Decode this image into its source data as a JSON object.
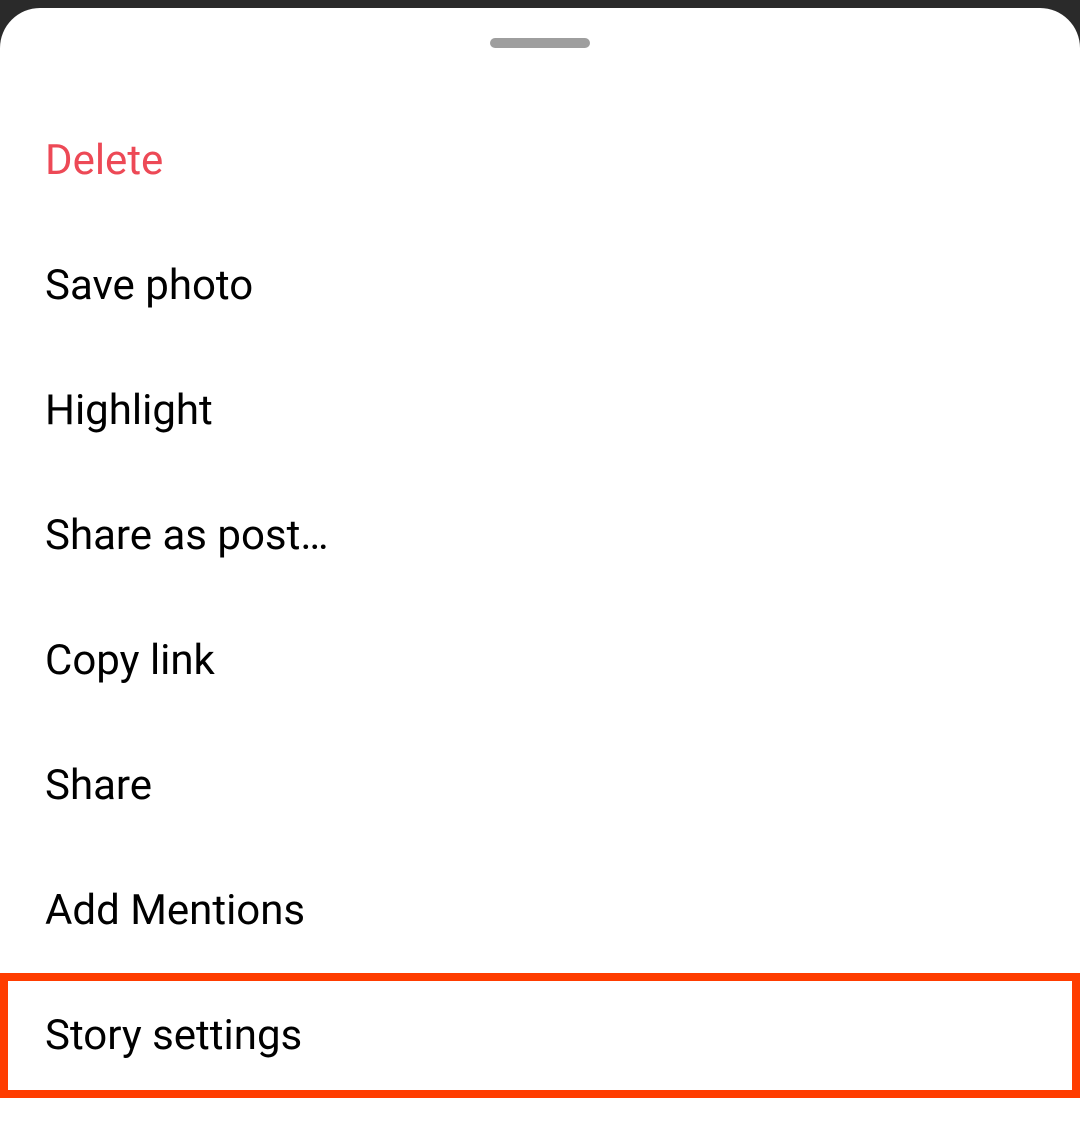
{
  "colors": {
    "destructive": "#ed4956",
    "highlight_border": "#ff3d00"
  },
  "menu": {
    "items": [
      {
        "label": "Delete",
        "destructive": true
      },
      {
        "label": "Save photo",
        "destructive": false
      },
      {
        "label": "Highlight",
        "destructive": false
      },
      {
        "label": "Share as post…",
        "destructive": false
      },
      {
        "label": "Copy link",
        "destructive": false
      },
      {
        "label": "Share",
        "destructive": false
      },
      {
        "label": "Add Mentions",
        "destructive": false
      },
      {
        "label": "Story settings",
        "destructive": false,
        "highlighted": true
      }
    ]
  }
}
